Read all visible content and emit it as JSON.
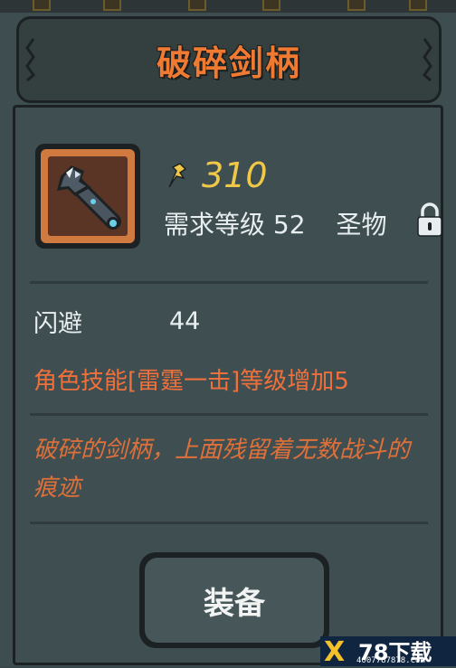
{
  "title": "破碎剑柄",
  "item": {
    "icon": "broken-sword-hilt",
    "price": "310",
    "price_icon": "gold-coin-icon",
    "requirement": "需求等级 52",
    "category": "圣物",
    "locked": true
  },
  "stats": [
    {
      "label": "闪避",
      "value": "44"
    }
  ],
  "skill_bonus": "角色技能[雷霆一击]等级增加5",
  "description": "破碎的剑柄，上面残留着无数战斗的痕迹",
  "buttons": {
    "equip": "装备"
  },
  "watermark": {
    "x": "X",
    "title": "78下载",
    "url": "4007787878.Com"
  },
  "colors": {
    "title": "#f07a32",
    "price": "#f0c848",
    "skill_text": "#f0703c",
    "description": "#e0703a",
    "panel_bg": "#3f4f51"
  }
}
